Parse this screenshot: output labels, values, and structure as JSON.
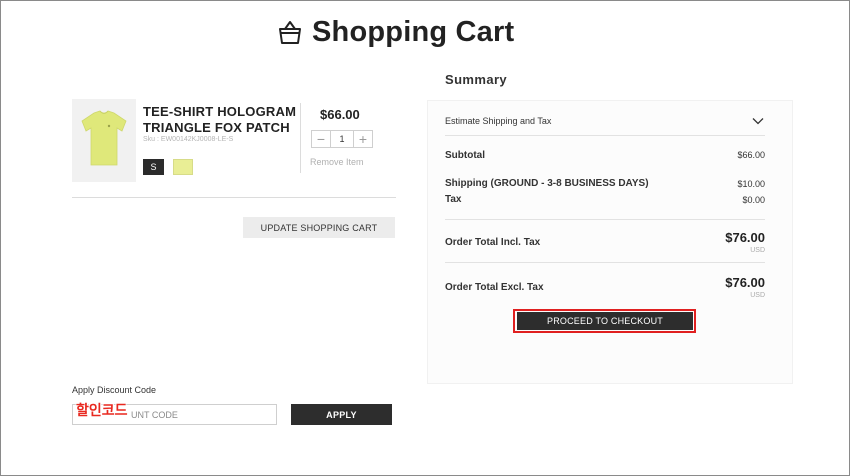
{
  "page": {
    "title": "Shopping Cart",
    "title_icon": "shopping-bag-icon"
  },
  "cart": {
    "item": {
      "name_line1": "TEE-SHIRT HOLOGRAM",
      "name_line2": "TRIANGLE FOX PATCH",
      "sku": "Sku : EW00142KJ0008-LE-S",
      "size": "S",
      "color_swatch": "#e9ee95",
      "price": "$66.00",
      "quantity": "1",
      "remove_label": "Remove Item"
    },
    "update_button": "UPDATE SHOPPING CART"
  },
  "discount": {
    "label": "Apply Discount Code",
    "placeholder": "ENTER DISCOUNT CODE",
    "visible_placeholder": "UNT CODE",
    "overlay_annotation": "할인코드",
    "apply_button": "APPLY"
  },
  "summary": {
    "title": "Summary",
    "estimate_label": "Estimate Shipping and Tax",
    "subtotal_label": "Subtotal",
    "subtotal_value": "$66.00",
    "shipping_label": "Shipping (GROUND - 3-8 BUSINESS DAYS)",
    "shipping_value": "$10.00",
    "tax_label": "Tax",
    "tax_value": "$0.00",
    "total_incl_label": "Order Total Incl. Tax",
    "total_incl_value": "$76.00",
    "total_incl_currency": "USD",
    "total_excl_label": "Order Total Excl. Tax",
    "total_excl_value": "$76.00",
    "total_excl_currency": "USD",
    "checkout_button": "PROCEED TO CHECKOUT"
  },
  "colors": {
    "highlight": "#e02020",
    "dark_button": "#2d2d2d",
    "product": "#dfe87a"
  }
}
